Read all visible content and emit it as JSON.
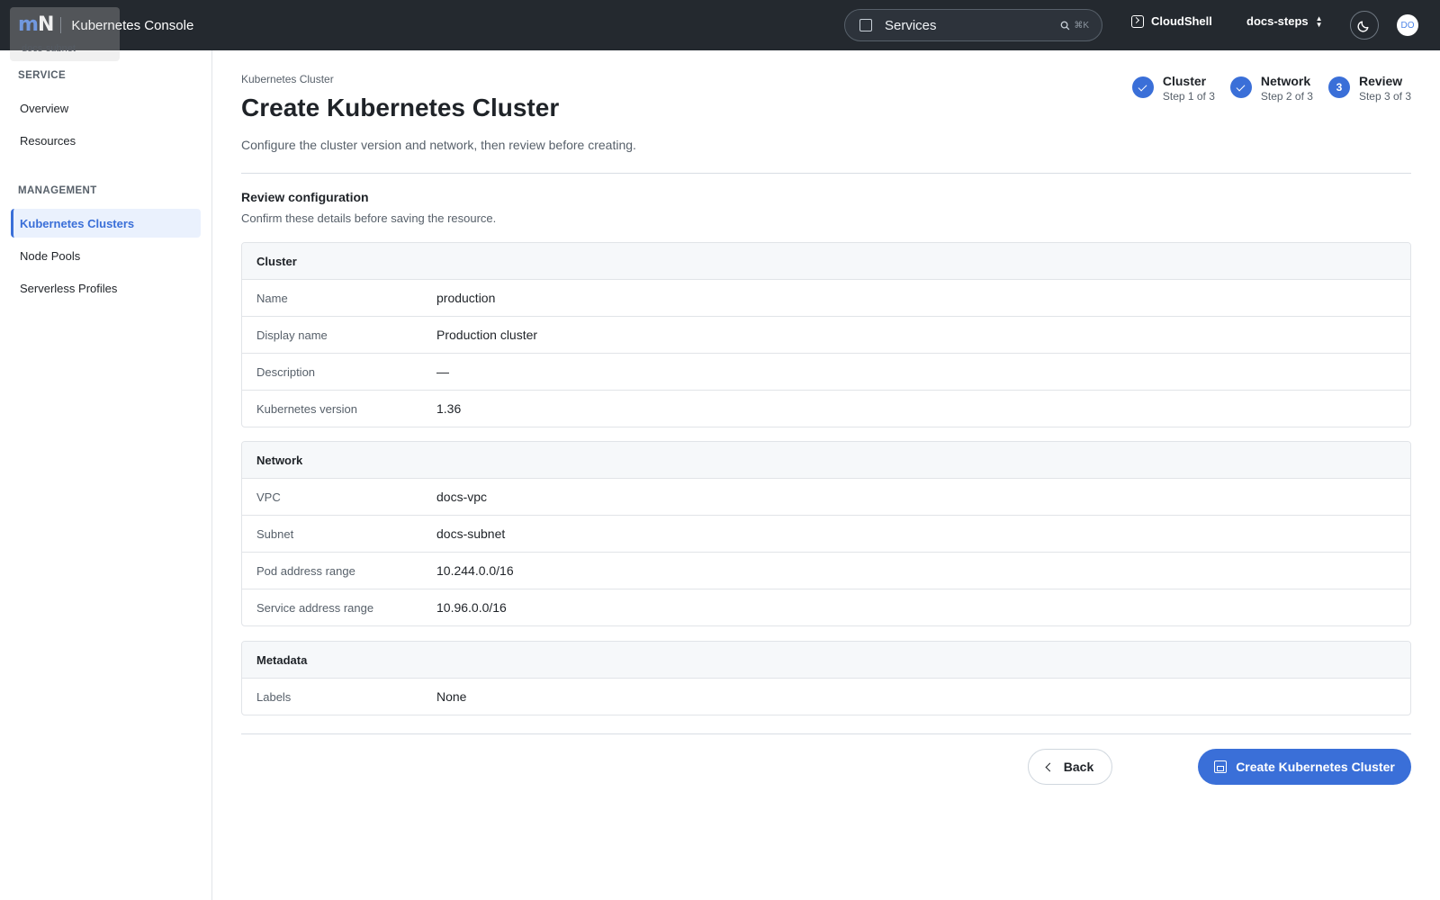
{
  "header": {
    "logo_m": "m",
    "logo_n": "N",
    "app_title": "Kubernetes Console",
    "overlay_tip": "docs-subnet",
    "search_label": "Services",
    "search_shortcut": "⌘K",
    "cloudshell_label": "CloudShell",
    "project_label": "docs-steps",
    "avatar_initials": "DO"
  },
  "sidebar": {
    "sections": [
      {
        "title": "SERVICE",
        "items": [
          "Overview",
          "Resources"
        ]
      },
      {
        "title": "MANAGEMENT",
        "items": [
          "Kubernetes Clusters",
          "Node Pools",
          "Serverless Profiles"
        ]
      }
    ],
    "active_item": "Kubernetes Clusters"
  },
  "main": {
    "breadcrumb": "Kubernetes Cluster",
    "title": "Create Kubernetes Cluster",
    "description": "Configure the cluster version and network, then review before creating.",
    "steps": [
      {
        "name": "Cluster",
        "sub": "Step 1 of 3",
        "state": "complete"
      },
      {
        "name": "Network",
        "sub": "Step 2 of 3",
        "state": "complete"
      },
      {
        "name": "Review",
        "sub": "Step 3 of 3",
        "state": "current",
        "number": "3"
      }
    ],
    "review_title": "Review configuration",
    "review_subtitle": "Confirm these details before saving the resource.",
    "cards": [
      {
        "title": "Cluster",
        "rows": [
          {
            "key": "Name",
            "value": "production"
          },
          {
            "key": "Display name",
            "value": "Production cluster"
          },
          {
            "key": "Description",
            "value": "—"
          },
          {
            "key": "Kubernetes version",
            "value": "1.36"
          }
        ]
      },
      {
        "title": "Network",
        "rows": [
          {
            "key": "VPC",
            "value": "docs-vpc"
          },
          {
            "key": "Subnet",
            "value": "docs-subnet"
          },
          {
            "key": "Pod address range",
            "value": "10.244.0.0/16"
          },
          {
            "key": "Service address range",
            "value": "10.96.0.0/16"
          }
        ]
      },
      {
        "title": "Metadata",
        "rows": [
          {
            "key": "Labels",
            "value": "None"
          }
        ]
      }
    ],
    "back_label": "Back",
    "create_label": "Create Kubernetes Cluster"
  },
  "colors": {
    "accent": "#3a6fd8",
    "topbar": "#24292f"
  }
}
